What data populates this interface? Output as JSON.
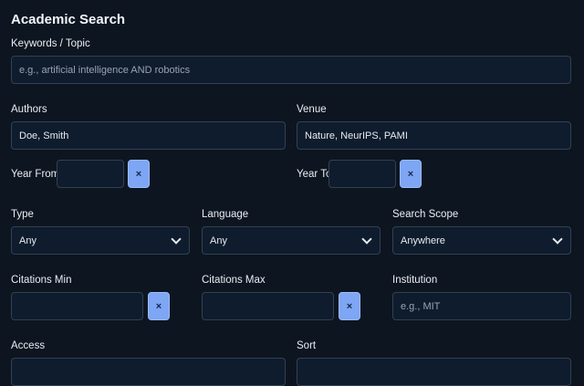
{
  "header": {
    "title": "Academic Search"
  },
  "keywords": {
    "label": "Keywords / Topic",
    "placeholder": "e.g., artificial intelligence AND robotics",
    "value": ""
  },
  "authors": {
    "label": "Authors",
    "value": "Doe, Smith"
  },
  "venue": {
    "label": "Venue",
    "value": "Nature, NeurIPS, PAMI"
  },
  "year_from": {
    "label": "Year From",
    "value": "",
    "clear_label": "×"
  },
  "year_to": {
    "label": "Year To",
    "value": "",
    "clear_label": "×"
  },
  "type": {
    "label": "Type",
    "selected": "Any"
  },
  "language": {
    "label": "Language",
    "selected": "Any"
  },
  "scope": {
    "label": "Search Scope",
    "selected": "Anywhere"
  },
  "citations_min": {
    "label": "Citations Min",
    "value": "",
    "clear_label": "×"
  },
  "citations_max": {
    "label": "Citations Max",
    "value": "",
    "clear_label": "×"
  },
  "institution": {
    "label": "Institution",
    "placeholder": "e.g., MIT",
    "value": ""
  },
  "access": {
    "label": "Access"
  },
  "sort": {
    "label": "Sort"
  },
  "colors": {
    "accent": "#7ea6f5",
    "background": "#0d1520",
    "field_bg": "#0f1c2d",
    "border": "#314152"
  },
  "icons": {
    "clear": "close-icon",
    "dropdown": "chevron-down-icon"
  }
}
